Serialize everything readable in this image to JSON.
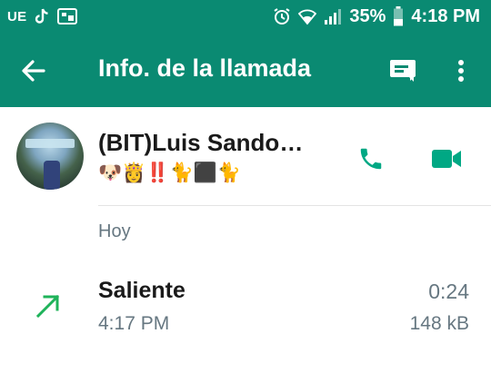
{
  "status_bar": {
    "carrier": "UE",
    "battery_percent": "35%",
    "time": "4:18 PM",
    "icons": [
      "tiktok-icon",
      "notification-app-icon",
      "alarm-icon",
      "wifi-icon",
      "signal-icon",
      "battery-icon"
    ]
  },
  "app_bar": {
    "title": "Info. de la llamada",
    "icons": [
      "back-arrow-icon",
      "message-icon",
      "more-vert-icon"
    ]
  },
  "contact": {
    "name": "(BIT)Luis Sando…",
    "status": "🐶👸‼️🐈⬛🐈"
  },
  "section_label": "Hoy",
  "call": {
    "type": "Saliente",
    "time": "4:17 PM",
    "duration": "0:24",
    "size": "148 kB",
    "direction_icon": "outgoing-arrow-icon"
  },
  "colors": {
    "header": "#0a8a72",
    "accent_green": "#00a884",
    "outgoing_arrow": "#1fb35a",
    "secondary_text": "#667781"
  }
}
